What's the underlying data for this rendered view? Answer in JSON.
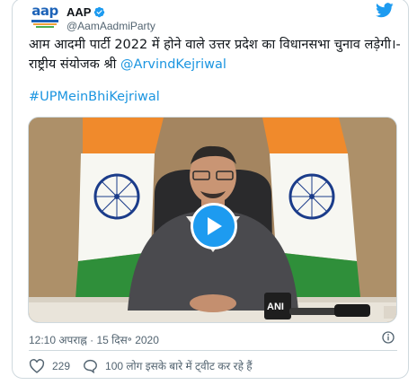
{
  "author": {
    "display_name": "AAP",
    "handle": "@AamAadmiParty",
    "logo_text": "aap"
  },
  "tweet": {
    "text_main": "आम आदमी पार्टी 2022 में होने वाले उत्तर प्रदेश का विधानसभा चुनाव लड़ेगी।- राष्ट्रीय संयोजक श्री ",
    "mention": "@ArvindKejriwal",
    "hashtag": "#UPMeinBhiKejriwal",
    "timestamp": "12:10 अपराह्न · 15 दिस॰ 2020"
  },
  "media": {
    "type": "video",
    "mic_label": "ANI"
  },
  "actions": {
    "likes": "229",
    "conversation": "100 लोग इसके बारे में ट्वीट कर रहे हैं"
  },
  "colors": {
    "accent": "#1d9bf0",
    "link": "#1b95e0",
    "secondary_text": "#536471",
    "border": "#cfd9de",
    "logo_blue": "#1d63b8"
  },
  "icons": {
    "brand": "twitter-bird-icon",
    "verified": "verified-badge-icon",
    "info": "info-icon",
    "like": "heart-icon",
    "reply": "speech-bubble-icon",
    "play": "play-icon"
  }
}
